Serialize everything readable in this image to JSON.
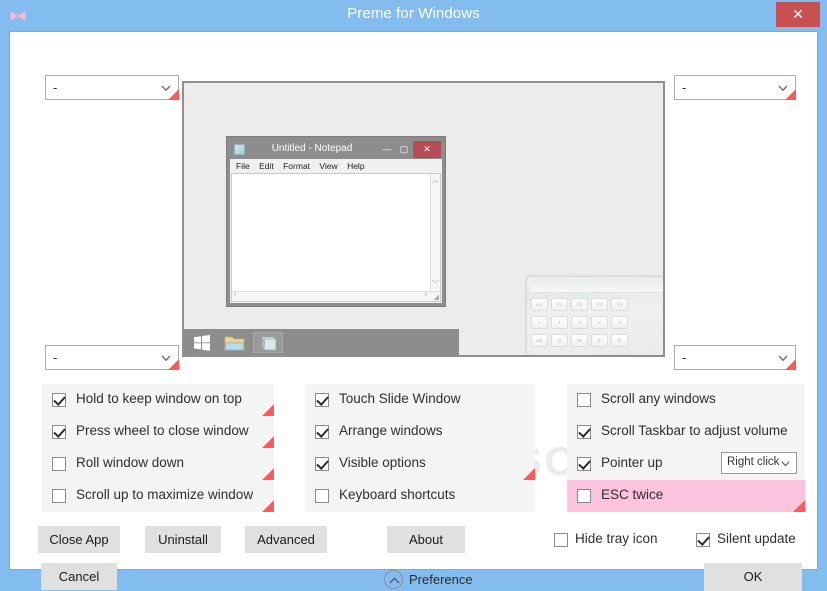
{
  "window": {
    "title": "Preme for Windows",
    "icon": "butterfly-icon",
    "close_label": "✕",
    "titlebar_color": "#83bdf0",
    "close_button_color": "#c75050"
  },
  "corner_selectors": {
    "top_left": {
      "value": "-",
      "marker": "red-corner-marker"
    },
    "top_right": {
      "value": "-",
      "marker": "red-corner-marker"
    },
    "bottom_left": {
      "value": "-",
      "marker": "red-corner-marker"
    },
    "bottom_right": {
      "value": "-",
      "marker": "red-corner-marker"
    }
  },
  "preview": {
    "notepad": {
      "title": "Untitled - Notepad",
      "minimize": "—",
      "maximize": "▢",
      "close": "✕",
      "menu": [
        "File",
        "Edit",
        "Format",
        "View",
        "Help"
      ],
      "scroll_up": "︿",
      "scroll_down": "﹀",
      "scroll_left": "‹",
      "scroll_right": "›",
      "grip": "◢"
    },
    "taskbar": {
      "items": [
        "windows-start-icon",
        "file-explorer-icon",
        "notepad-icon"
      ]
    },
    "keyboard_keys": {
      "row1": [
        "esc",
        "F1",
        "F2",
        "F3",
        "F4"
      ],
      "row2": [
        "~",
        "1",
        "2",
        "3",
        "4"
      ],
      "row3": [
        "tab",
        "Q",
        "W",
        "E",
        "R"
      ]
    }
  },
  "options": {
    "column1": [
      {
        "label": "Hold to keep window on top",
        "checked": true,
        "marker": true
      },
      {
        "label": "Press wheel to close window",
        "checked": true,
        "marker": true
      },
      {
        "label": "Roll window down",
        "checked": false,
        "marker": true
      },
      {
        "label": "Scroll up to maximize window",
        "checked": false,
        "marker": true
      }
    ],
    "column2": [
      {
        "label": "Touch Slide Window",
        "checked": true,
        "marker": false
      },
      {
        "label": "Arrange windows",
        "checked": true,
        "marker": false
      },
      {
        "label": "Visible options",
        "checked": true,
        "marker": true
      },
      {
        "label": "Keyboard shortcuts",
        "checked": false,
        "marker": false
      }
    ],
    "column3": [
      {
        "label": "Scroll any windows",
        "checked": false,
        "marker": false
      },
      {
        "label": "Scroll Taskbar to adjust volume",
        "checked": true,
        "marker": false
      },
      {
        "label": "Pointer up",
        "checked": true,
        "marker": false,
        "combo_value": "Right click"
      },
      {
        "label": "ESC twice",
        "checked": false,
        "marker": true,
        "highlighted": true
      }
    ]
  },
  "highlight_color": "#fbc3de",
  "marker_color": "#fc5a5a",
  "buttons": {
    "close_app": "Close App",
    "uninstall": "Uninstall",
    "advanced": "Advanced",
    "cancel": "Cancel",
    "about": "About",
    "ok": "OK",
    "preference": "Preference"
  },
  "footer_checkboxes": [
    {
      "label": "Hide tray icon",
      "checked": false
    },
    {
      "label": "Silent update",
      "checked": true
    }
  ],
  "watermark": "SOFTPEDIA"
}
